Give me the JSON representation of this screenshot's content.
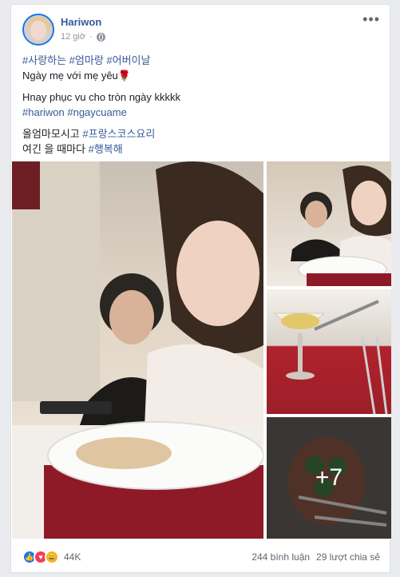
{
  "post": {
    "author": "Hariwon",
    "time": "12 giờ",
    "more_label": "•••",
    "lines": [
      [
        "#사랑하는 #엄마랑 #어버이날"
      ],
      [
        "Ngày mẹ với mẹ yêu🌹"
      ],
      [
        "Hnay phục vu cho tròn ngày kkkkk"
      ],
      [
        "#hariwon #ngaycuame"
      ],
      [
        "올엄마모시고 #프랑스코스요리"
      ],
      [
        "여긴 을 때마다 #행복해"
      ]
    ],
    "line1": "#사랑하는 #엄마랑 #어버이날",
    "line2": "Ngày mẹ với mẹ yêu🌹",
    "line3": "Hnay phục vu cho tròn ngày kkkkk",
    "line4": "#hariwon #ngaycuame",
    "line5_prefix": "올엄마모시고 ",
    "line5_tag": "#프랑스코스요리",
    "line6_prefix": "여긴 을 때마다 ",
    "line6_tag": "#행복해"
  },
  "photos": {
    "more_count": "+7"
  },
  "footer": {
    "reaction_icons": [
      "like-icon",
      "love-icon",
      "haha-icon"
    ],
    "reaction_count": "44K",
    "comments": "244 bình luận",
    "shares": "29 lượt chia sẻ"
  },
  "colors": {
    "link": "#385898",
    "like": "#1877f2",
    "love": "#f33e58",
    "haha": "#f7b125"
  }
}
